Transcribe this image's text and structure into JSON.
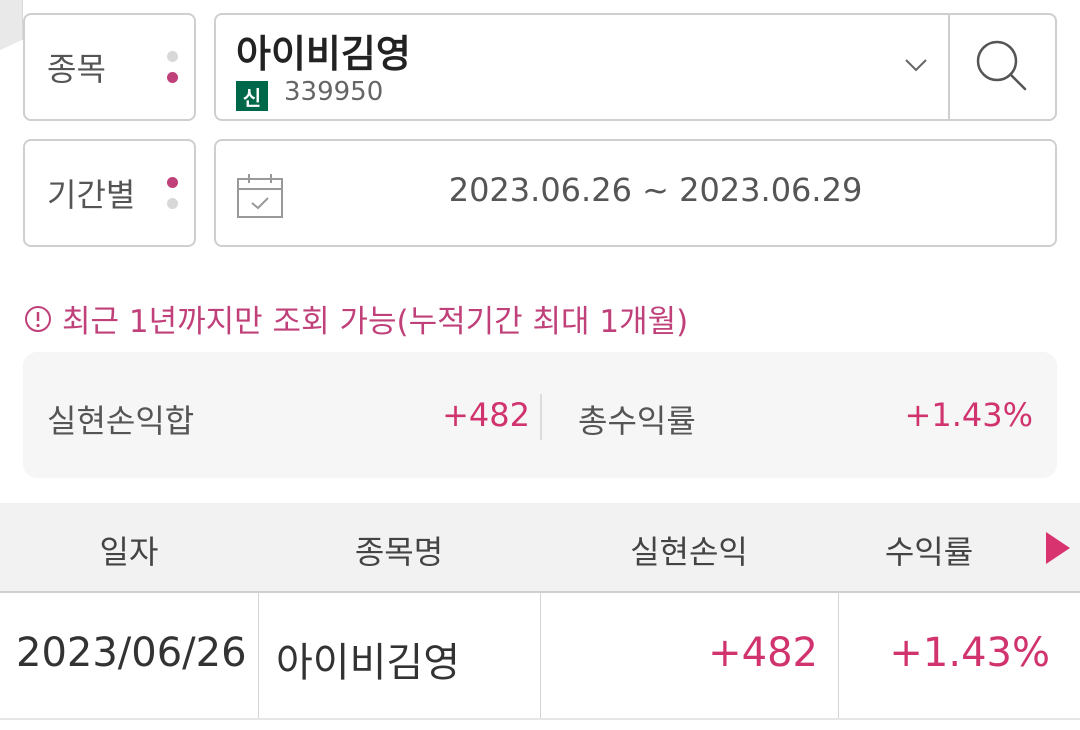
{
  "filters": {
    "stock_label": "종목",
    "period_label": "기간별",
    "stock": {
      "name": "아이비김영",
      "badge": "신",
      "code": "339950"
    },
    "date_range": "2023.06.26 ~ 2023.06.29"
  },
  "notice": "최근 1년까지만 조회 가능(누적기간 최대 1개월)",
  "summary": {
    "realized_pl_label": "실현손익합",
    "realized_pl_value": "+482",
    "total_return_label": "총수익률",
    "total_return_value": "+1.43%"
  },
  "table": {
    "headers": [
      "일자",
      "종목명",
      "실현손익",
      "수익률"
    ],
    "rows": [
      {
        "date": "2023/06/26",
        "name": "아이비김영",
        "pl": "+482",
        "return": "+1.43%"
      }
    ]
  },
  "colors": {
    "accent": "#d0336e",
    "badge": "#00684a"
  },
  "icons": [
    "search-icon",
    "chevron-down-icon",
    "calendar-icon",
    "info-icon",
    "next-arrow-icon"
  ]
}
